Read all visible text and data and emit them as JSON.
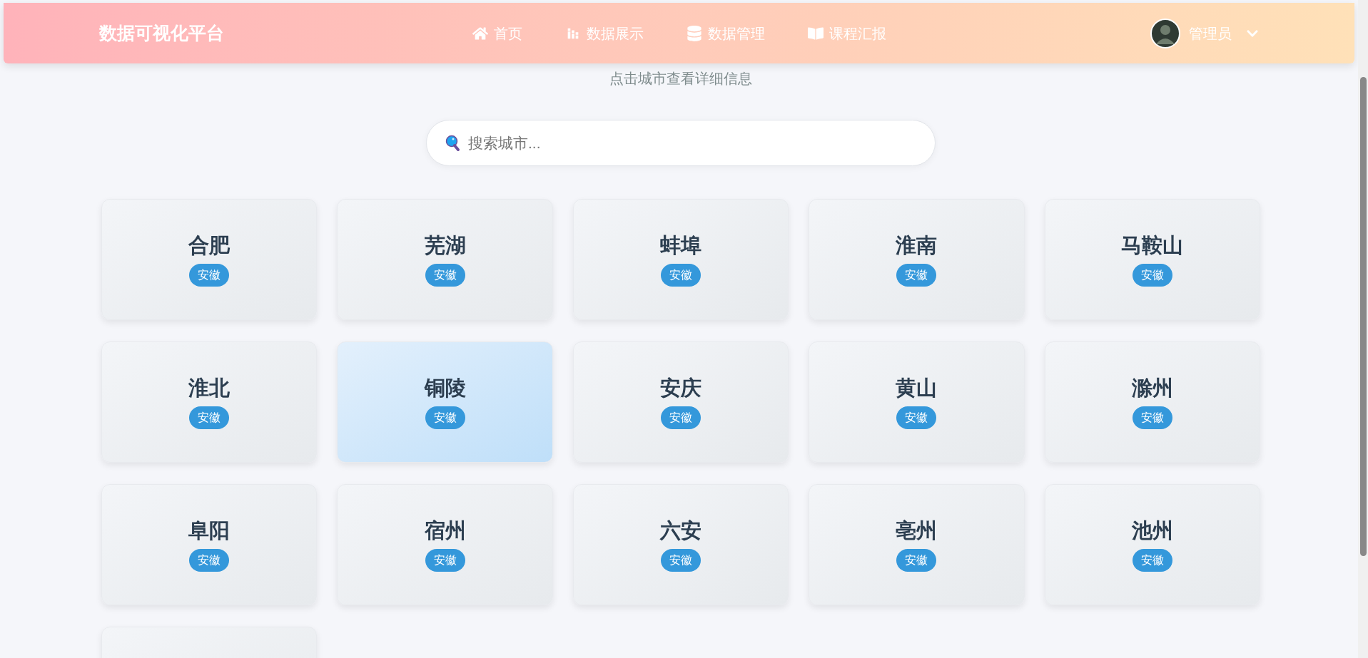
{
  "header": {
    "title": "数据可视化平台",
    "nav": [
      {
        "label": "首页",
        "selected": false
      },
      {
        "label": "数据展示",
        "selected": false
      },
      {
        "label": "数据管理",
        "selected": false
      },
      {
        "label": "课程汇报",
        "selected": false
      }
    ],
    "user": {
      "name": "管理员"
    }
  },
  "subtitle": "点击城市查看详细信息",
  "search": {
    "placeholder": "搜索城市..."
  },
  "cities": [
    {
      "kind": "city",
      "name": "合肥",
      "province": "安徽",
      "selected": false
    },
    {
      "kind": "city",
      "name": "芜湖",
      "province": "安徽",
      "selected": false
    },
    {
      "kind": "city",
      "name": "蚌埠",
      "province": "安徽",
      "selected": false
    },
    {
      "kind": "city",
      "name": "淮南",
      "province": "安徽",
      "selected": false
    },
    {
      "kind": "city",
      "name": "马鞍山",
      "province": "安徽",
      "selected": false
    },
    {
      "kind": "city",
      "name": "淮北",
      "province": "安徽",
      "selected": false
    },
    {
      "kind": "city",
      "name": "铜陵",
      "province": "安徽",
      "selected": true
    },
    {
      "kind": "city",
      "name": "安庆",
      "province": "安徽",
      "selected": false
    },
    {
      "kind": "city",
      "name": "黄山",
      "province": "安徽",
      "selected": false
    },
    {
      "kind": "city",
      "name": "滁州",
      "province": "安徽",
      "selected": false
    },
    {
      "kind": "city",
      "name": "阜阳",
      "province": "安徽",
      "selected": false
    },
    {
      "kind": "city",
      "name": "宿州",
      "province": "安徽",
      "selected": false
    },
    {
      "kind": "city",
      "name": "六安",
      "province": "安徽",
      "selected": false
    },
    {
      "kind": "city",
      "name": "亳州",
      "province": "安徽",
      "selected": false
    },
    {
      "kind": "city",
      "name": "池州",
      "province": "安徽",
      "selected": false
    },
    {
      "kind": "cut-off",
      "selected": false
    }
  ]
}
